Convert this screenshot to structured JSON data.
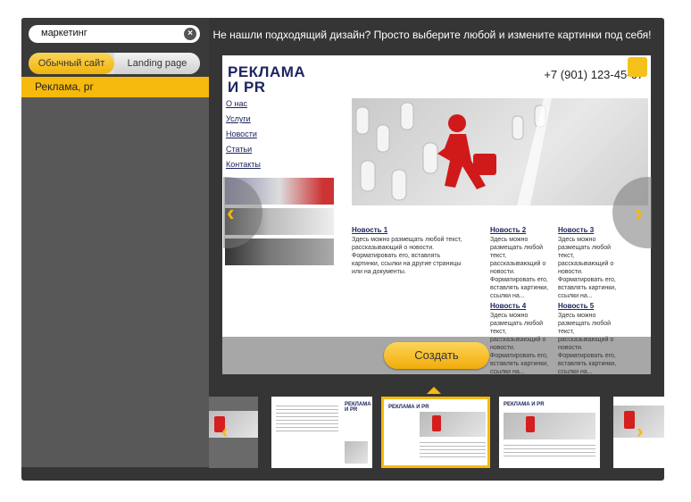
{
  "search": {
    "query": "маркетинг",
    "clear_icon": "close-icon"
  },
  "tabs": {
    "regular": "Обычный сайт",
    "landing": "Landing page"
  },
  "categories": [
    {
      "label": "Реклама, pr",
      "selected": true
    }
  ],
  "hint": "Не нашли подходящий дизайн? Просто выберите любой и измените картинки под себя!",
  "preview": {
    "title_line1": "РЕКЛАМА",
    "title_line2": "И PR",
    "phone": "+7 (901) 123-45-67",
    "nav": [
      "О нас",
      "Услуги",
      "Новости",
      "Статьи",
      "Контакты"
    ],
    "news": [
      {
        "title": "Новость 1",
        "text": "Здесь можно размещать любой текст, рассказывающий о новости. Форматировать его, вставлять картинки, ссылки на другие страницы или на документы."
      },
      {
        "title": "Новость 2",
        "text": "Здесь можно размещать любой текст, рассказывающий о новости. Форматировать его, вставлять картинки, ссылки на..."
      },
      {
        "title": "Новость 3",
        "text": "Здесь можно размещать любой текст, рассказывающий о новости. Форматировать его, вставлять картинки, ссылки на..."
      },
      {
        "title": "Новость 4",
        "text": "Здесь можно размещать любой текст, рассказывающий о новости. Форматировать его, вставлять картинки, ссылки на..."
      },
      {
        "title": "Новость 5",
        "text": "Здесь можно размещать любой текст, рассказывающий о новости. Форматировать его, вставлять картинки, ссылки на..."
      }
    ]
  },
  "create_button": "Создать",
  "thumbs": [
    {
      "title": "",
      "selected": false
    },
    {
      "title": "РЕКЛАМА И PR",
      "selected": false
    },
    {
      "title": "РЕКЛАМА И PR",
      "selected": true
    },
    {
      "title": "РЕКЛАМА И PR",
      "selected": false
    },
    {
      "title": "",
      "selected": false
    }
  ],
  "colors": {
    "accent": "#f6b90d",
    "panel": "#353535",
    "sidebar": "#585858",
    "brand": "#1d2560"
  }
}
